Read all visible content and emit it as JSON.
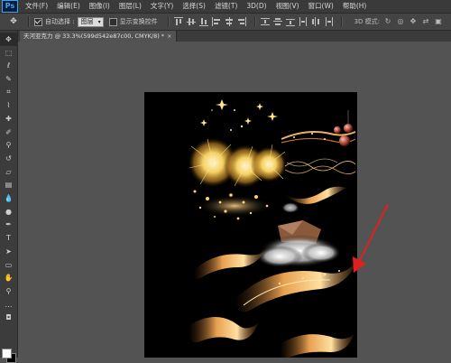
{
  "app": {
    "logo_text": "Ps"
  },
  "menu": [
    "文件(F)",
    "编辑(E)",
    "图像(I)",
    "图层(L)",
    "文字(Y)",
    "选择(S)",
    "滤镜(T)",
    "3D(D)",
    "视图(V)",
    "窗口(W)",
    "帮助(H)"
  ],
  "options": {
    "auto_select_label": "自动选择 :",
    "auto_select_value": "图层",
    "show_transform_label": "显示变换控件",
    "mode_3d_label": "3D 模式:"
  },
  "document": {
    "tab_title": "天河亚克力 @ 33.3%(599d542e87c00, CMYK/8) *"
  },
  "colors": {
    "foreground": "#ffffff",
    "background": "#000000",
    "arrow": "#e02020"
  },
  "tools": [
    "move-tool-icon",
    "marquee-tool-icon",
    "lasso-tool-icon",
    "quick-select-tool-icon",
    "crop-tool-icon",
    "eyedropper-tool-icon",
    "healing-brush-tool-icon",
    "brush-tool-icon",
    "clone-stamp-tool-icon",
    "history-brush-tool-icon",
    "eraser-tool-icon",
    "gradient-tool-icon",
    "blur-tool-icon",
    "dodge-tool-icon",
    "pen-tool-icon",
    "type-tool-icon",
    "path-select-tool-icon",
    "rectangle-tool-icon",
    "hand-tool-icon",
    "zoom-tool-icon",
    "extras-icon"
  ]
}
